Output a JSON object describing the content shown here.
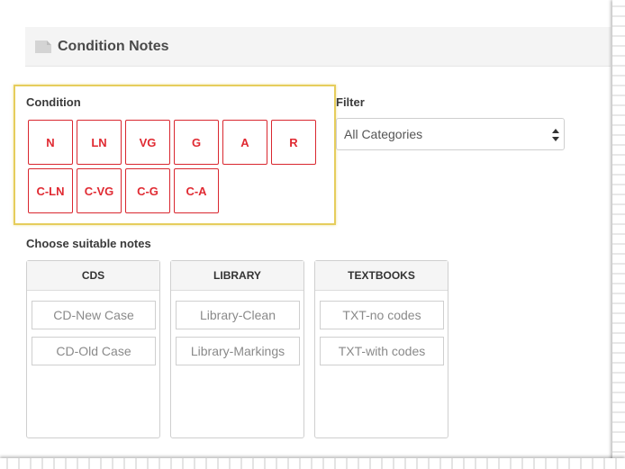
{
  "header": {
    "title": "Condition Notes",
    "icon": "document-icon"
  },
  "condition": {
    "label": "Condition",
    "buttons": [
      "N",
      "LN",
      "VG",
      "G",
      "A",
      "R",
      "C-LN",
      "C-VG",
      "C-G",
      "C-A"
    ]
  },
  "filter": {
    "label": "Filter",
    "selected": "All Categories"
  },
  "notes": {
    "label": "Choose suitable notes",
    "columns": [
      {
        "title": "CDS",
        "items": [
          "CD-New Case",
          "CD-Old Case"
        ]
      },
      {
        "title": "LIBRARY",
        "items": [
          "Library-Clean",
          "Library-Markings"
        ]
      },
      {
        "title": "TEXTBOOKS",
        "items": [
          "TXT-no codes",
          "TXT-with codes"
        ]
      }
    ]
  },
  "colors": {
    "accent_red": "#e02a32",
    "highlight_yellow": "#e6cd5c"
  }
}
